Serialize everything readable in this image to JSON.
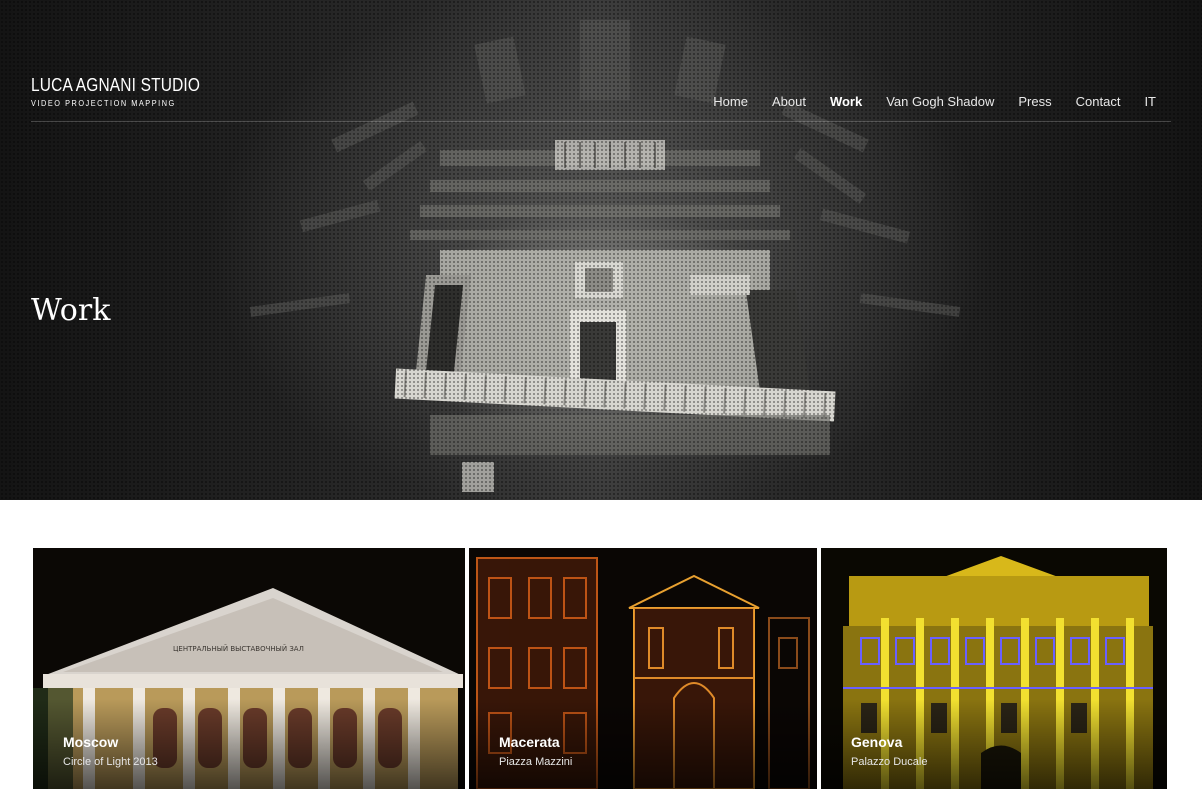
{
  "logo": {
    "title": "LUCA AGNANI STUDIO",
    "subtitle": "VIDEO PROJECTION MAPPING"
  },
  "nav": [
    {
      "label": "Home",
      "active": false
    },
    {
      "label": "About",
      "active": false
    },
    {
      "label": "Work",
      "active": true
    },
    {
      "label": "Van Gogh Shadow",
      "active": false
    },
    {
      "label": "Press",
      "active": false
    },
    {
      "label": "Contact",
      "active": false
    },
    {
      "label": "IT",
      "active": false
    }
  ],
  "hero": {
    "title": "Work"
  },
  "projects": [
    {
      "title": "Moscow",
      "subtitle": "Circle of Light 2013"
    },
    {
      "title": "Macerata",
      "subtitle": "Piazza Mazzini"
    },
    {
      "title": "Genova",
      "subtitle": "Palazzo Ducale"
    }
  ],
  "moscow_sign": "ЦЕНТРАЛЬНЫЙ ВЫСТАВОЧНЫЙ ЗАЛ",
  "colors": {
    "hero_bg": "#2a2a2a",
    "page_bg": "#ffffff",
    "text_light": "#ffffff"
  }
}
